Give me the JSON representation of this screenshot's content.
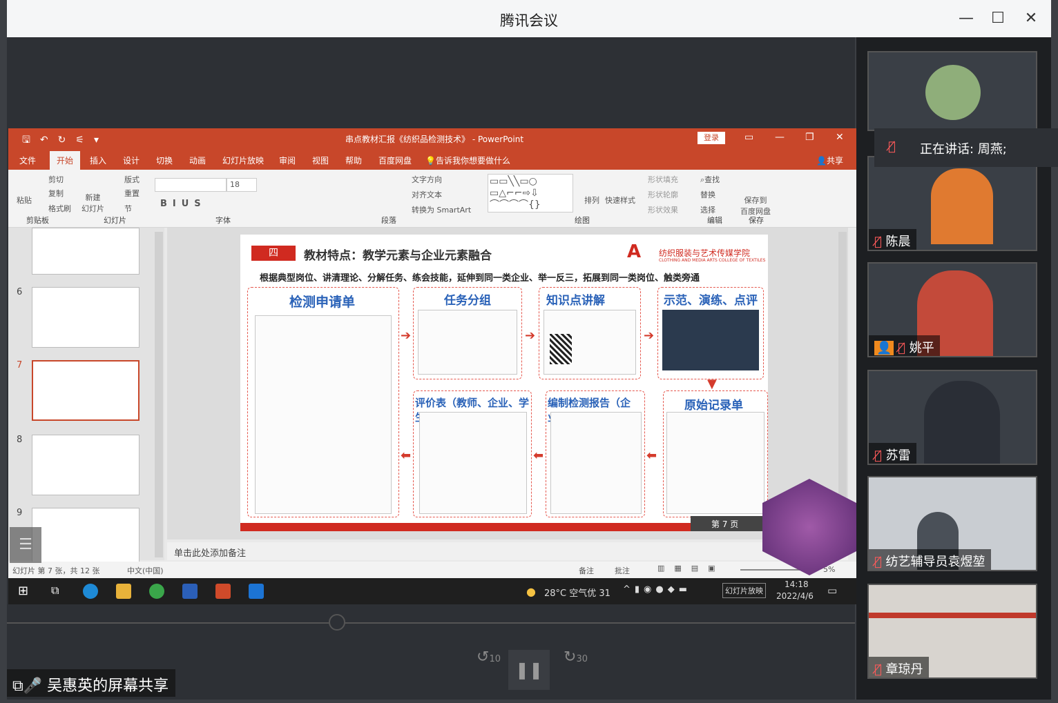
{
  "app": {
    "title": "腾讯会议"
  },
  "ppt": {
    "window_title": "串点教材汇报《纺织品检测技术》 - PowerPoint",
    "login": "登录",
    "menu": [
      "文件",
      "开始",
      "插入",
      "设计",
      "切换",
      "动画",
      "幻灯片放映",
      "审阅",
      "视图",
      "帮助",
      "百度网盘",
      "告诉我你想要做什么"
    ],
    "share": "共享",
    "ribbon": {
      "clipboard": "剪贴板",
      "paste": "粘贴",
      "cut": "剪切",
      "copy": "复制",
      "format_painter": "格式刷",
      "slides": "幻灯片",
      "new_slide": "新建\n幻灯片",
      "layout": "版式",
      "reset": "重置",
      "section": "节",
      "font": "字体",
      "font_size": "18",
      "paragraph": "段落",
      "text_direction": "文字方向",
      "align_text": "对齐文本",
      "smartart": "转换为 SmartArt",
      "drawing": "绘图",
      "arrange": "排列",
      "quick_styles": "快速样式",
      "shape_fill": "形状填充",
      "shape_outline": "形状轮廓",
      "shape_effects": "形状效果",
      "editing": "编辑",
      "find": "查找",
      "replace": "替换",
      "select": "选择",
      "save": "保存",
      "save_to": "保存到\n百度网盘"
    },
    "thumb_numbers": [
      "6",
      "7",
      "8",
      "9"
    ],
    "notes_placeholder": "单击此处添加备注",
    "status_left": "幻灯片 第 7 张，共 12 张",
    "language": "中文(中国)",
    "status_notes": "备注",
    "status_comments": "批注",
    "zoom": "5%"
  },
  "slide": {
    "badge": "四",
    "heading": "教材特点：教学元素与企业元素融合",
    "logo_cn": "纺织服装与艺术传媒学院",
    "logo_en": "CLOTHING AND MEDIA ARTS COLLEGE OF TEXTILES",
    "subtitle": "根据典型岗位、讲清理论、分解任务、练会技能，延伸到同一类企业、举一反三，拓展到同一类岗位、触类旁通",
    "boxes": {
      "b1": "检测申请单",
      "b2": "任务分组",
      "b3": "知识点讲解",
      "b4": "示范、演练、点评",
      "b5": "评价表（教师、企业、学生）",
      "b6": "编制检测报告（企业）",
      "b7": "原始记录单"
    },
    "page_label": "第  7  页"
  },
  "taskbar": {
    "weather": "28°C 空气优 31",
    "slideshow": "幻灯片放映",
    "time": "14:18",
    "date": "2022/4/6"
  },
  "player": {
    "rewind": "10",
    "forward": "30"
  },
  "share_label": "吴惠英的屏幕共享",
  "speaking": "正在讲话: 周燕;",
  "participants": [
    "陈晨",
    "姚平",
    "苏雷",
    "纺艺辅导员袁煜堃",
    "章琼丹"
  ],
  "colors": {
    "ppt_red": "#c8472a",
    "accent_blue": "#2a62b8"
  }
}
